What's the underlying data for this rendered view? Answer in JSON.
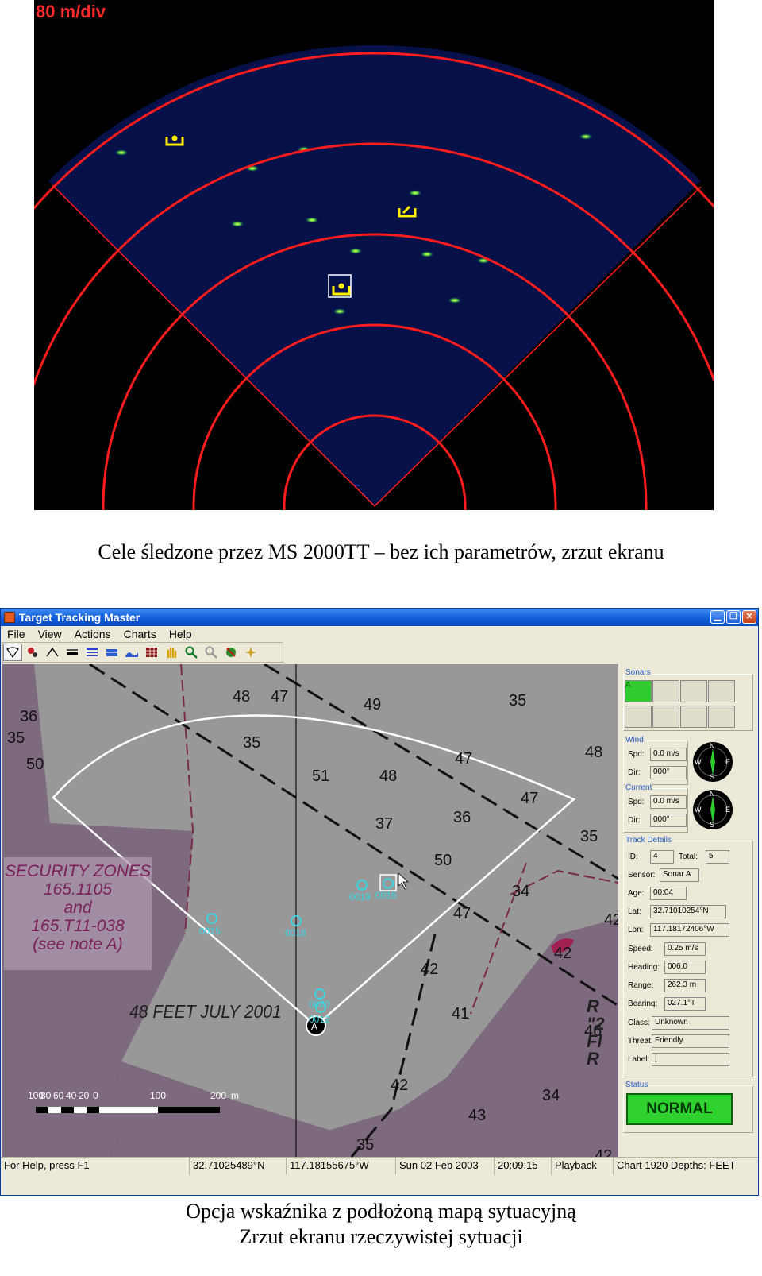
{
  "sonar": {
    "scale_label": "80 m/div"
  },
  "caption_top": "Cele śledzone przez MS 2000TT – bez ich parametrów, zrzut ekranu",
  "window": {
    "title": "Target Tracking Master",
    "menu": [
      "File",
      "View",
      "Actions",
      "Charts",
      "Help"
    ],
    "toolbar_icons": [
      "sector-icon",
      "targets-icon",
      "nmea-icon",
      "range-100-icon",
      "layers-icon",
      "depth-bars-icon",
      "seabed-icon",
      "grid-icon",
      "pan-hand-icon",
      "zoom-in-icon",
      "zoom-out-icon",
      "no-target-icon",
      "compass-rose-icon"
    ],
    "map": {
      "depths": [
        "48",
        "47",
        "49",
        "35",
        "36",
        "35",
        "50",
        "35",
        "51",
        "48",
        "47",
        "48",
        "37",
        "36",
        "47",
        "35",
        "50",
        "34",
        "47",
        "42",
        "42",
        "42",
        "41",
        "46",
        "42",
        "34",
        "43",
        "35",
        "42",
        "41",
        "35",
        "42"
      ],
      "zone_lines": [
        "SECURITY ZONES",
        "165.1105",
        "and",
        "165.T11-038",
        "(see note A)"
      ],
      "chart_note": "48 FEET JULY 2001",
      "rfl_lines": [
        "R \"2",
        "Fl R"
      ],
      "tracks": [
        "0019",
        "0016",
        "0015",
        "0018",
        "0020",
        "0012"
      ],
      "sensor_marker": "A",
      "scale_labels": [
        "100",
        "80",
        "60",
        "40",
        "20",
        "0",
        "100",
        "200",
        "m"
      ]
    },
    "panel": {
      "sonars_title": "Sonars",
      "sonar_active_label": "A",
      "wind": {
        "title": "Wind",
        "spd_label": "Spd:",
        "spd": "0.0 m/s",
        "dir_label": "Dir:",
        "dir": "000°"
      },
      "current": {
        "title": "Current",
        "spd_label": "Spd:",
        "spd": "0.0 m/s",
        "dir_label": "Dir:",
        "dir": "000°"
      },
      "compass_letters": [
        "N",
        "E",
        "S",
        "W"
      ],
      "track_details": {
        "title": "Track Details",
        "id_label": "ID:",
        "id": "4",
        "total_label": "Total:",
        "total": "5",
        "sensor_label": "Sensor:",
        "sensor": "Sonar A",
        "age_label": "Age:",
        "age": "00:04",
        "lat_label": "Lat:",
        "lat": "32.71010254°N",
        "lon_label": "Lon:",
        "lon": "117.18172406°W",
        "speed_label": "Speed:",
        "speed": "0.25 m/s",
        "heading_label": "Heading:",
        "heading": "006.0",
        "range_label": "Range:",
        "range": "262.3 m",
        "bearing_label": "Bearing:",
        "bearing": "027.1°T",
        "class_label": "Class:",
        "class": "Unknown",
        "threat_label": "Threat:",
        "threat": "Friendly",
        "label_label": "Label:",
        "label": "|"
      },
      "status": {
        "title": "Status",
        "value": "NORMAL"
      }
    },
    "statusbar": [
      "For Help, press F1",
      "32.71025489°N",
      "117.18155675°W",
      "Sun 02 Feb 2003",
      "20:09:15",
      "Playback",
      "Chart 1920 Depths: FEET"
    ]
  },
  "caption_bottom_1": "Opcja wskaźnika z podłożoną mapą sytuacyjną",
  "caption_bottom_2": "Zrzut ekranu rzeczywistej sytuacji"
}
